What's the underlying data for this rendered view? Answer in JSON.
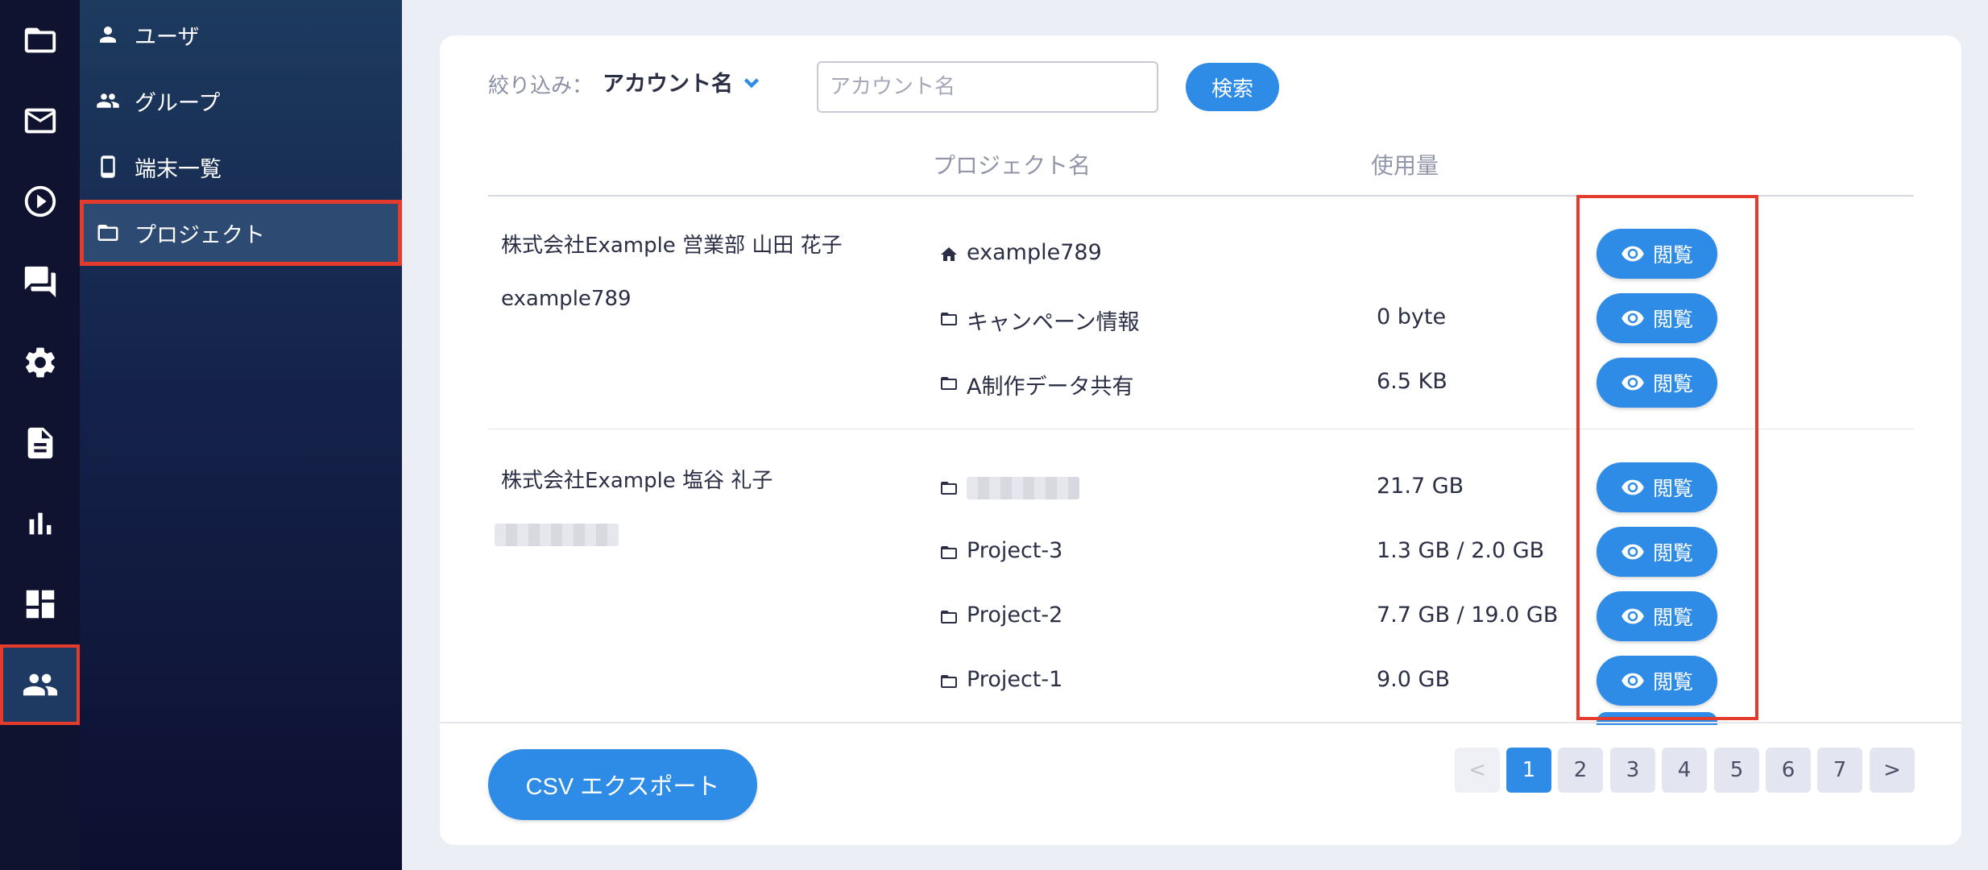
{
  "rail": {
    "items": [
      {
        "icon": "folder-icon"
      },
      {
        "icon": "mail-icon"
      },
      {
        "icon": "play-icon"
      },
      {
        "icon": "chat-icon"
      },
      {
        "icon": "gear-icon"
      },
      {
        "icon": "document-icon"
      },
      {
        "icon": "bar-chart-icon"
      },
      {
        "icon": "dashboard-icon"
      },
      {
        "icon": "people-icon",
        "active": true
      }
    ]
  },
  "subnav": {
    "items": [
      {
        "label": "ユーザ",
        "icon": "person-icon"
      },
      {
        "label": "グループ",
        "icon": "group-icon"
      },
      {
        "label": "端末一覧",
        "icon": "phone-icon"
      },
      {
        "label": "プロジェクト",
        "icon": "folder-icon",
        "active": true
      }
    ]
  },
  "filter": {
    "label": "絞り込み：",
    "selected": "アカウント名",
    "input_placeholder": "アカウント名",
    "search_label": "検索"
  },
  "table": {
    "headers": {
      "project": "プロジェクト名",
      "usage": "使用量"
    },
    "view_label": "閲覧",
    "groups": [
      {
        "account_name": "株式会社Example 営業部 山田 花子",
        "account_id": "example789",
        "rows": [
          {
            "icon": "home-icon",
            "name": "example789",
            "usage": ""
          },
          {
            "icon": "folder-icon",
            "name": "キャンペーン情報",
            "usage": "0 byte"
          },
          {
            "icon": "folder-icon",
            "name": "A制作データ共有",
            "usage": "6.5 KB"
          }
        ]
      },
      {
        "account_name": "株式会社Example 塩谷 礼子",
        "account_id": "",
        "rows": [
          {
            "icon": "folder-icon",
            "name": "",
            "usage": "21.7 GB"
          },
          {
            "icon": "folder-icon",
            "name": "Project-3",
            "usage": "1.3 GB / 2.0 GB"
          },
          {
            "icon": "folder-icon",
            "name": "Project-2",
            "usage": "7.7 GB / 19.0 GB"
          },
          {
            "icon": "folder-icon",
            "name": "Project-1",
            "usage": "9.0 GB"
          }
        ]
      }
    ]
  },
  "footer": {
    "csv_label": "CSV エクスポート",
    "pager": {
      "prev": "<",
      "next": ">",
      "pages": [
        "1",
        "2",
        "3",
        "4",
        "5",
        "6",
        "7"
      ],
      "current": "1"
    }
  },
  "colors": {
    "accent": "#2e8be6",
    "highlight": "#e53b2c",
    "rail_bg": "#0f1330"
  }
}
